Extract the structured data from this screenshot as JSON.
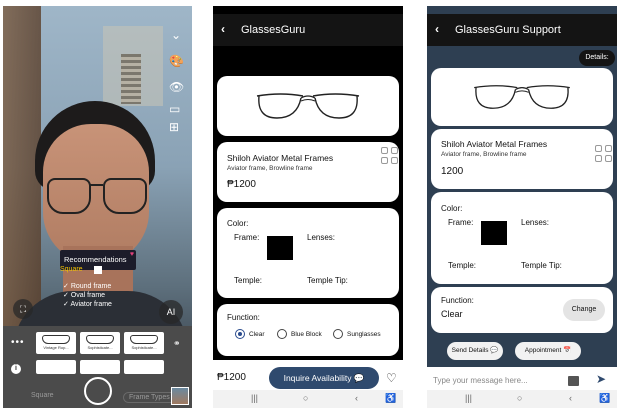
{
  "camera": {
    "recommendations_label": "Recommendations",
    "square_label": "Square",
    "shapes": [
      "Round frame",
      "Oval frame",
      "Aviator frame"
    ],
    "ai_label": "AI",
    "thumbnails": [
      "Vintage Rop...",
      "Sophisticate...",
      "Sophisticate..."
    ],
    "mode_left": "Square",
    "mode_right": "Frame Types"
  },
  "product": {
    "app_title": "GlassesGuru",
    "name": "Shiloh Aviator Metal Frames",
    "subtitle": "Aviator frame, Browline frame",
    "price": "₱1200",
    "color_label": "Color:",
    "frame_label": "Frame:",
    "lenses_label": "Lenses:",
    "temple_label": "Temple:",
    "temple_tip_label": "Temple Tip:",
    "function_label": "Function:",
    "function_options": [
      "Clear",
      "Blue Block",
      "Sunglasses"
    ],
    "selected_function": "Clear",
    "bottom_price": "₱1200",
    "inquire_label": "Inquire Availability 💬"
  },
  "support": {
    "app_title": "GlassesGuru Support",
    "details_chip": "Details:",
    "name": "Shiloh Aviator Metal Frames",
    "subtitle": "Aviator frame, Browline frame",
    "price": "1200",
    "color_label": "Color:",
    "frame_label": "Frame:",
    "lenses_label": "Lenses:",
    "temple_label": "Temple:",
    "temple_tip_label": "Temple Tip:",
    "function_label": "Function:",
    "function_value": "Clear",
    "change_label": "Change",
    "send_details_label": "Send Details 💬",
    "appointment_label": "Appointment 📅",
    "message_placeholder": "Type your message here..."
  },
  "colors": {
    "accent": "#2f4a6e",
    "frame_swatch": "#000000",
    "support_bg": "#2e3f52"
  }
}
